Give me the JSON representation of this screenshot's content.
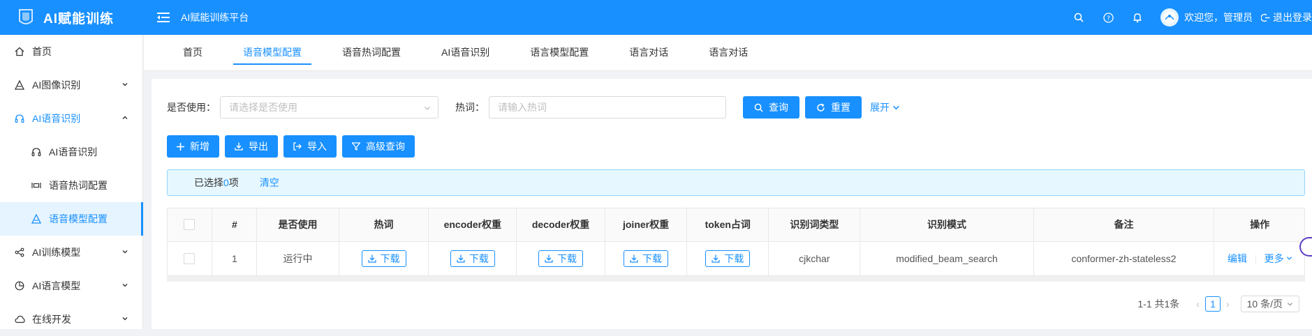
{
  "app": {
    "logo_title": "AI赋能训练",
    "platform_title": "AI赋能训练平台",
    "welcome": "欢迎您，管理员",
    "logout": "退出登录"
  },
  "sidebar": {
    "items": [
      {
        "label": "首页",
        "icon": "home-icon"
      },
      {
        "label": "AI图像识别",
        "icon": "image-recognition-icon"
      },
      {
        "label": "AI语音识别",
        "icon": "headset-icon"
      },
      {
        "label": "AI语音识别",
        "icon": "headset-icon"
      },
      {
        "label": "语音热词配置",
        "icon": "hotword-icon"
      },
      {
        "label": "语音模型配置",
        "icon": "model-icon"
      },
      {
        "label": "AI训练模型",
        "icon": "share-icon"
      },
      {
        "label": "AI语言模型",
        "icon": "pie-chart-icon"
      },
      {
        "label": "在线开发",
        "icon": "cloud-icon"
      }
    ]
  },
  "tabs": [
    "首页",
    "语音模型配置",
    "语音热词配置",
    "AI语音识别",
    "语言模型配置",
    "语言对话",
    "语言对话"
  ],
  "search": {
    "use_label": "是否使用：",
    "use_placeholder": "请选择是否使用",
    "hotword_label": "热词：",
    "hotword_placeholder": "请输入热词",
    "query_btn": "查询",
    "reset_btn": "重置",
    "expand": "展开"
  },
  "toolbar": {
    "add": "新增",
    "export": "导出",
    "import": "导入",
    "advanced": "高级查询"
  },
  "selection": {
    "prefix": "已选择",
    "count": "0",
    "suffix": "项",
    "clear": "清空"
  },
  "table": {
    "headers": [
      "#",
      "是否使用",
      "热词",
      "encoder权重",
      "decoder权重",
      "joiner权重",
      "token占词",
      "识别词类型",
      "识别模式",
      "备注",
      "操作"
    ],
    "rows": [
      {
        "index": "1",
        "status": "运行中",
        "download": "下载",
        "type": "cjkchar",
        "mode": "modified_beam_search",
        "remark": "conformer-zh-stateless2",
        "edit": "编辑",
        "more": "更多"
      }
    ]
  },
  "pagination": {
    "total": "1-1 共1条",
    "current": "1",
    "page_size": "10 条/页"
  },
  "colors": {
    "primary": "#1890ff",
    "alert_bg": "#e6f7ff"
  }
}
